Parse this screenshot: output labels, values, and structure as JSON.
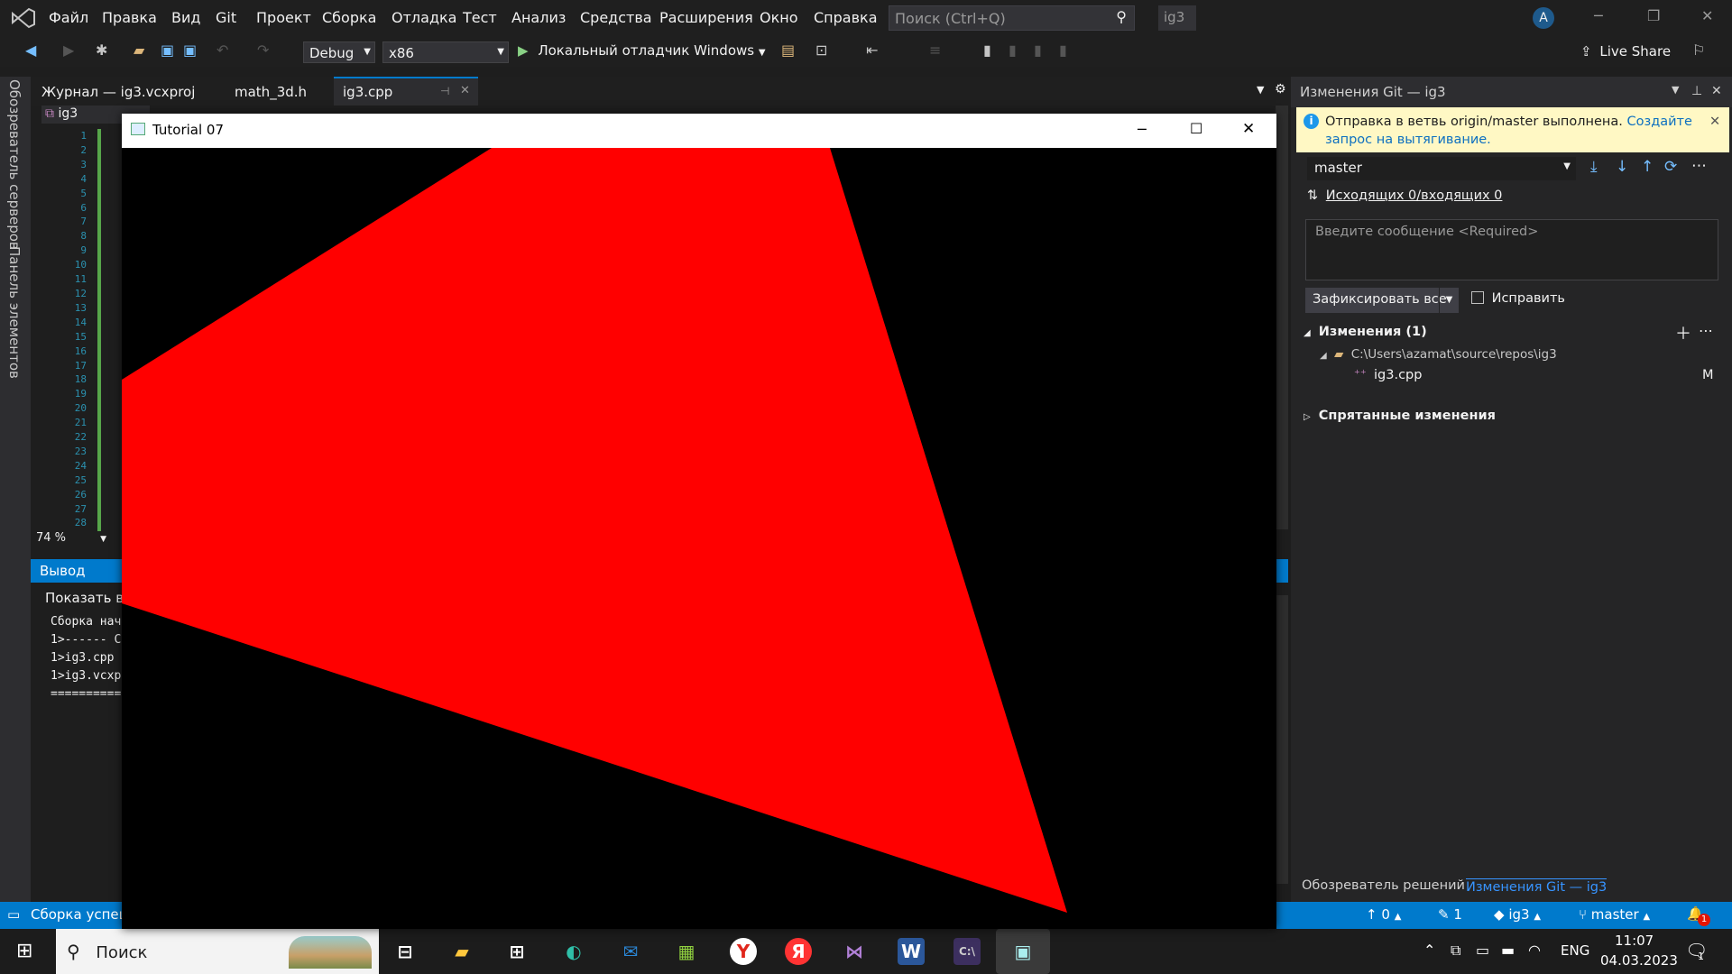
{
  "menu": [
    "Файл",
    "Правка",
    "Вид",
    "Git",
    "Проект",
    "Сборка",
    "Отладка",
    "Тест",
    "Анализ",
    "Средства",
    "Расширения",
    "Окно",
    "Справка"
  ],
  "search": {
    "placeholder": "Поиск (Ctrl+Q)"
  },
  "solution_badge": "ig3",
  "account_initial": "A",
  "toolbar": {
    "config": "Debug",
    "platform": "x86",
    "run_label": "Локальный отладчик Windows",
    "live_share": "Live Share"
  },
  "left_strip": {
    "server_explorer": "Обозреватель серверов",
    "toolbox": "Панель элементов"
  },
  "tabs": [
    "Журнал — ig3.vcxproj",
    "math_3d.h",
    "ig3.cpp"
  ],
  "editor": {
    "nav_project": "ig3",
    "line_numbers": [
      "1",
      "2",
      "3",
      "4",
      "5",
      "6",
      "7",
      "8",
      "9",
      "10",
      "11",
      "12",
      "13",
      "14",
      "15",
      "16",
      "17",
      "18",
      "19",
      "20",
      "21",
      "22",
      "23",
      "24",
      "25",
      "26",
      "27",
      "28"
    ],
    "zoom": "74 %"
  },
  "output": {
    "title": "Вывод",
    "show_from": "Показать вы",
    "lines": [
      "Сборка нач",
      "1>------ С",
      "1>ig3.cpp",
      "1>ig3.vcxp",
      "=========="
    ]
  },
  "app_window": {
    "title": "Tutorial 07",
    "fill_color": "#ff0000",
    "background_color": "#000000"
  },
  "git": {
    "panel_title": "Изменения Git — ig3",
    "info_text": "Отправка в ветвь origin/master выполнена.",
    "info_link": "Создайте запрос на вытягивание.",
    "branch": "master",
    "outgoing": "Исходящих 0/входящих 0",
    "message_placeholder": "Введите сообщение <Required>",
    "commit_all": "Зафиксировать все",
    "amend": "Исправить",
    "changes_header": "Изменения (1)",
    "repo_path": "C:\\Users\\azamat\\source\\repos\\ig3",
    "file": "ig3.cpp",
    "file_status": "M",
    "stashed": "Спрятанные изменения",
    "bottom_tabs": [
      "Обозреватель решений",
      "Изменения Git — ig3"
    ]
  },
  "status": {
    "left": "Сборка успеш",
    "push": "0",
    "edits": "1",
    "repo": "ig3",
    "branch": "master",
    "bell_count": "1"
  },
  "taskbar": {
    "search": "Поиск",
    "lang": "ENG",
    "time": "11:07",
    "date": "04.03.2023",
    "notif": "1"
  }
}
